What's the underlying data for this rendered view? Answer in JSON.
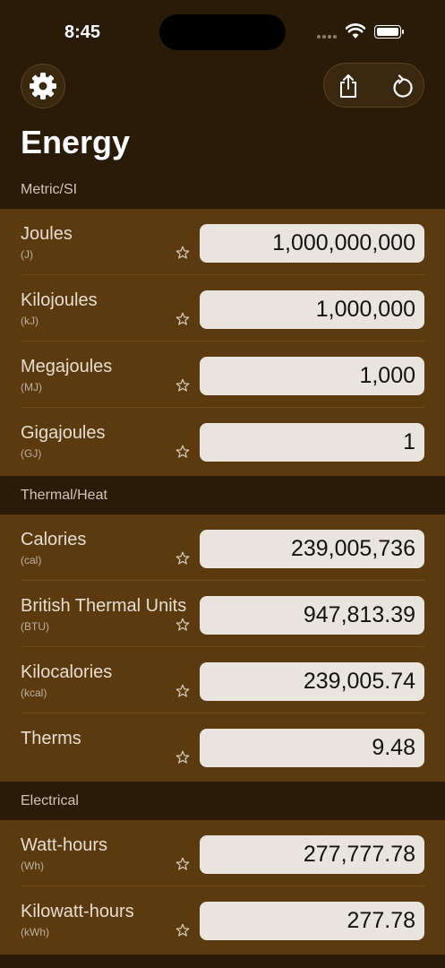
{
  "status": {
    "time": "8:45"
  },
  "header": {
    "title": "Energy"
  },
  "sections": [
    {
      "header": "Metric/SI",
      "rows": [
        {
          "name": "Joules",
          "abbr": "(J)",
          "value": "1,000,000,000"
        },
        {
          "name": "Kilojoules",
          "abbr": "(kJ)",
          "value": "1,000,000"
        },
        {
          "name": "Megajoules",
          "abbr": "(MJ)",
          "value": "1,000"
        },
        {
          "name": "Gigajoules",
          "abbr": "(GJ)",
          "value": "1"
        }
      ]
    },
    {
      "header": "Thermal/Heat",
      "rows": [
        {
          "name": "Calories",
          "abbr": "(cal)",
          "value": "239,005,736"
        },
        {
          "name": "British Thermal Units",
          "abbr": "(BTU)",
          "value": "947,813.39"
        },
        {
          "name": "Kilocalories",
          "abbr": "(kcal)",
          "value": "239,005.74"
        },
        {
          "name": "Therms",
          "abbr": "",
          "value": "9.48"
        }
      ]
    },
    {
      "header": "Electrical",
      "rows": [
        {
          "name": "Watt-hours",
          "abbr": "(Wh)",
          "value": "277,777.78"
        },
        {
          "name": "Kilowatt-hours",
          "abbr": "(kWh)",
          "value": "277.78"
        }
      ]
    }
  ]
}
